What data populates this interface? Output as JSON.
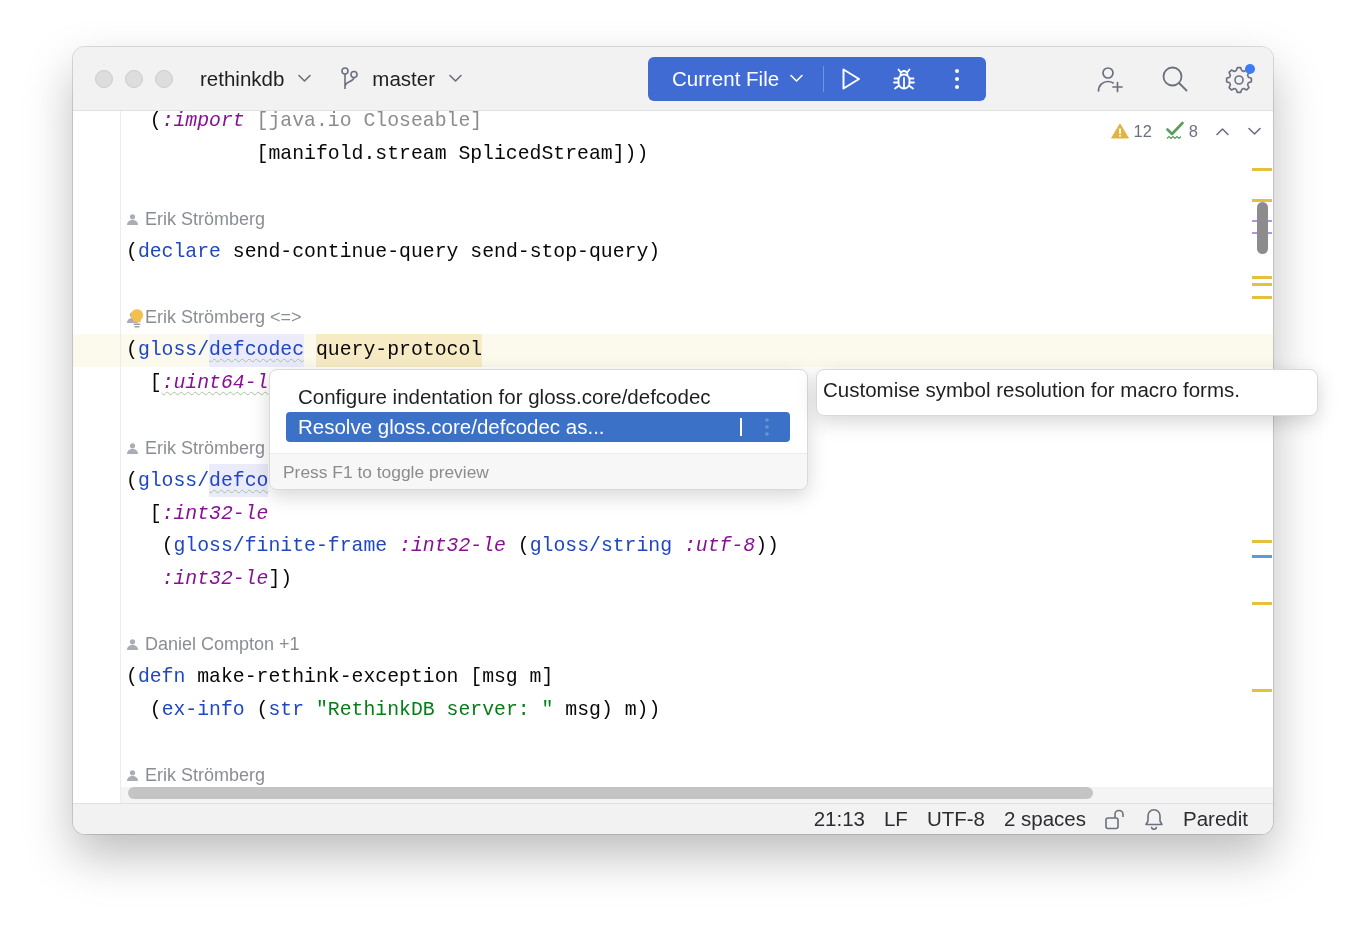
{
  "toolbar": {
    "project": "rethinkdb",
    "branch": "master",
    "run_config": "Current File"
  },
  "editor": {
    "inspections": [
      {
        "kind": "warning",
        "count": "12"
      },
      {
        "kind": "typo",
        "count": "8"
      }
    ],
    "lines": [
      {
        "kind": "code",
        "current": false,
        "tokens": [
          {
            "text": "  (",
            "kind": "plain"
          },
          {
            "text": ":import",
            "kind": "keyword"
          },
          {
            "text": " [java.io Closeable]",
            "kind": "unused"
          }
        ]
      },
      {
        "kind": "code",
        "current": false,
        "tokens": [
          {
            "text": "           [manifold.stream SplicedStream]))",
            "kind": "plain"
          }
        ]
      },
      {
        "kind": "blank"
      },
      {
        "kind": "author",
        "text": "Erik Strömberg",
        "bulb": false
      },
      {
        "kind": "code",
        "current": false,
        "tokens": [
          {
            "text": "(",
            "kind": "plain"
          },
          {
            "text": "declare",
            "kind": "builtin"
          },
          {
            "text": " send-continue-query send-stop-query)",
            "kind": "plain"
          }
        ]
      },
      {
        "kind": "blank"
      },
      {
        "kind": "author",
        "text": "Erik Strömberg <=>",
        "bulb": true
      },
      {
        "kind": "code",
        "current": true,
        "tokens": [
          {
            "text": "(",
            "kind": "plain"
          },
          {
            "text": "gloss/",
            "kind": "builtin"
          },
          {
            "text": "defcodec",
            "kind": "usage"
          },
          {
            "text": " query-protocol",
            "kind": "declaration"
          }
        ]
      },
      {
        "kind": "code",
        "current": false,
        "tokens": [
          {
            "text": "  [",
            "kind": "plain"
          },
          {
            "text": ":uint64-l",
            "kind": "flagged"
          }
        ]
      },
      {
        "kind": "blank"
      },
      {
        "kind": "author",
        "text": "Erik Strömberg",
        "bulb": false
      },
      {
        "kind": "code",
        "current": false,
        "tokens": [
          {
            "text": "(",
            "kind": "plain"
          },
          {
            "text": "gloss/",
            "kind": "builtin"
          },
          {
            "text": "defco",
            "kind": "usage"
          }
        ]
      },
      {
        "kind": "code",
        "current": false,
        "tokens": [
          {
            "text": "  [",
            "kind": "plain"
          },
          {
            "text": ":int32-le",
            "kind": "keyword"
          }
        ]
      },
      {
        "kind": "code",
        "current": false,
        "tokens": [
          {
            "text": "   (",
            "kind": "plain"
          },
          {
            "text": "gloss/finite-frame",
            "kind": "builtin"
          },
          {
            "text": " :int32-le",
            "kind": "keyword"
          },
          {
            "text": " (",
            "kind": "plain"
          },
          {
            "text": "gloss/string",
            "kind": "builtin"
          },
          {
            "text": " :utf-8",
            "kind": "keyword"
          },
          {
            "text": "))",
            "kind": "plain"
          }
        ]
      },
      {
        "kind": "code",
        "current": false,
        "tokens": [
          {
            "text": "   :int32-le",
            "kind": "keyword"
          },
          {
            "text": "])",
            "kind": "plain"
          }
        ]
      },
      {
        "kind": "blank"
      },
      {
        "kind": "author",
        "text": "Daniel Compton +1",
        "bulb": false
      },
      {
        "kind": "code",
        "current": false,
        "tokens": [
          {
            "text": "(",
            "kind": "plain"
          },
          {
            "text": "defn",
            "kind": "builtin"
          },
          {
            "text": " make-rethink-exception [msg m]",
            "kind": "plain"
          }
        ]
      },
      {
        "kind": "code",
        "current": false,
        "tokens": [
          {
            "text": "  (",
            "kind": "plain"
          },
          {
            "text": "ex-info",
            "kind": "builtin"
          },
          {
            "text": " (",
            "kind": "plain"
          },
          {
            "text": "str",
            "kind": "builtin"
          },
          {
            "text": " \"RethinkDB server: \"",
            "kind": "string"
          },
          {
            "text": " msg) m))",
            "kind": "plain"
          }
        ]
      },
      {
        "kind": "blank"
      },
      {
        "kind": "author",
        "text": "Erik Strömberg",
        "bulb": false
      }
    ]
  },
  "popup": {
    "items": [
      {
        "text": "Configure indentation for gloss.core/defcodec",
        "selected": false
      },
      {
        "text": "Resolve gloss.core/defcodec as...",
        "selected": true
      }
    ],
    "footer": "Press F1 to toggle preview"
  },
  "doc_popup": {
    "text": "Customise symbol resolution for macro forms."
  },
  "status_bar": {
    "items": [
      "21:13",
      "LF",
      "UTF-8",
      "2 spaces"
    ],
    "mode": "Paredit"
  }
}
